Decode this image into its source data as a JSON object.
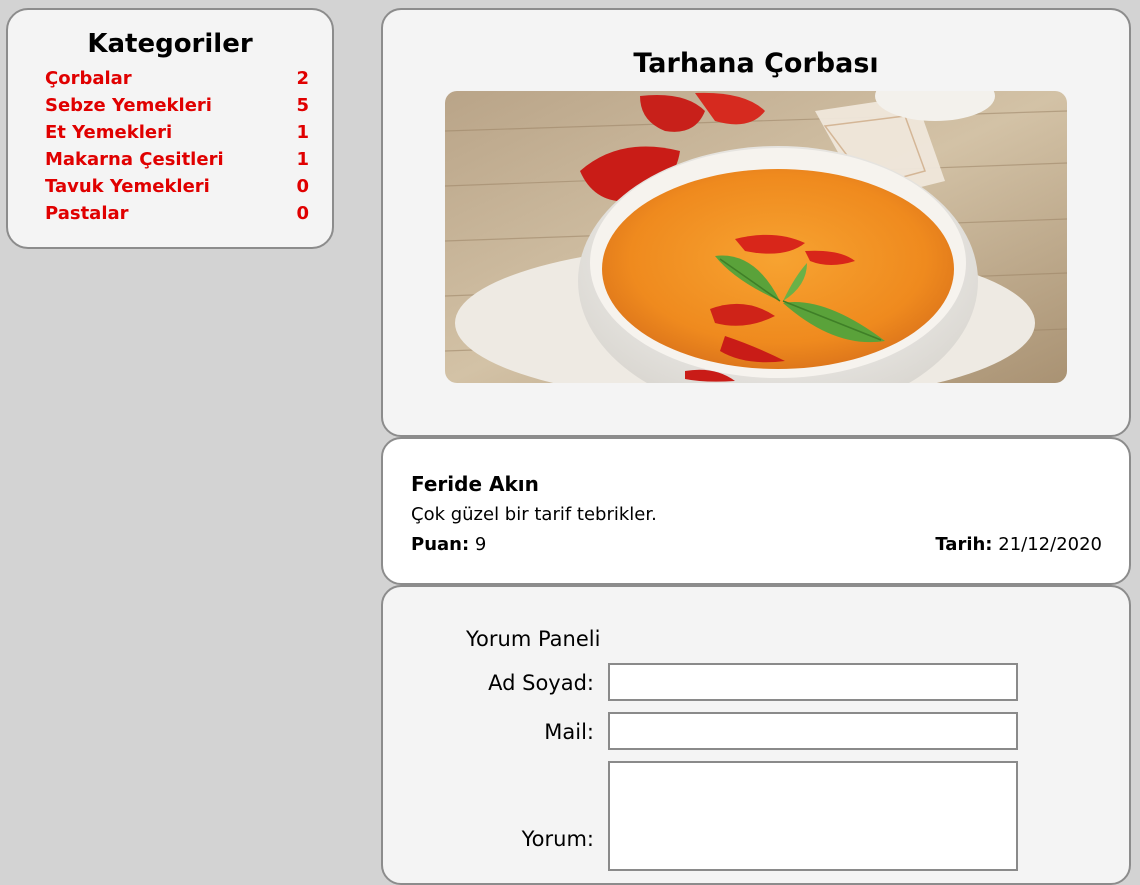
{
  "sidebar": {
    "title": "Kategoriler",
    "categories": [
      {
        "name": "Çorbalar",
        "count": "2"
      },
      {
        "name": "Sebze Yemekleri",
        "count": "5"
      },
      {
        "name": "Et Yemekleri",
        "count": "1"
      },
      {
        "name": "Makarna Çesitleri",
        "count": "1"
      },
      {
        "name": "Tavuk Yemekleri",
        "count": "0"
      },
      {
        "name": "Pastalar",
        "count": "0"
      }
    ]
  },
  "recipe": {
    "title": "Tarhana Çorbası"
  },
  "comment": {
    "author": "Feride Akın",
    "text": "Çok güzel bir tarif tebrikler.",
    "score_label": "Puan:",
    "score": "9",
    "date_label": "Tarih:",
    "date": "21/12/2020"
  },
  "form": {
    "title": "Yorum Paneli",
    "name_label": "Ad Soyad:",
    "name_value": "",
    "mail_label": "Mail:",
    "mail_value": "",
    "comment_label": "Yorum:",
    "comment_value": ""
  },
  "colors": {
    "page_background": "#d3d3d3",
    "panel_background": "#f4f4f4",
    "category_link": "#e00000",
    "border": "#8c8c8c"
  }
}
